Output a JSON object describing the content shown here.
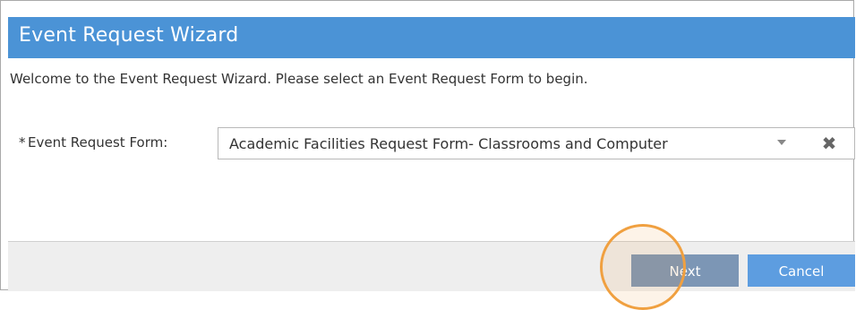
{
  "dialog": {
    "title": "Event Request Wizard",
    "intro": "Welcome to the Event Request Wizard. Please select an Event Request Form to begin."
  },
  "form": {
    "required_marker": "*",
    "label": "Event Request Form:",
    "selected_value": "Academic Facilities Request Form- Classrooms and Computer",
    "dropdown_icon": "chevron-down-icon",
    "clear_icon": "close-icon"
  },
  "footer": {
    "next_label": "Next",
    "cancel_label": "Cancel"
  },
  "colors": {
    "titlebar": "#4b93d6",
    "next_button": "#7c96b5",
    "cancel_button": "#5d9de0",
    "highlight_ring": "#f0a040"
  }
}
